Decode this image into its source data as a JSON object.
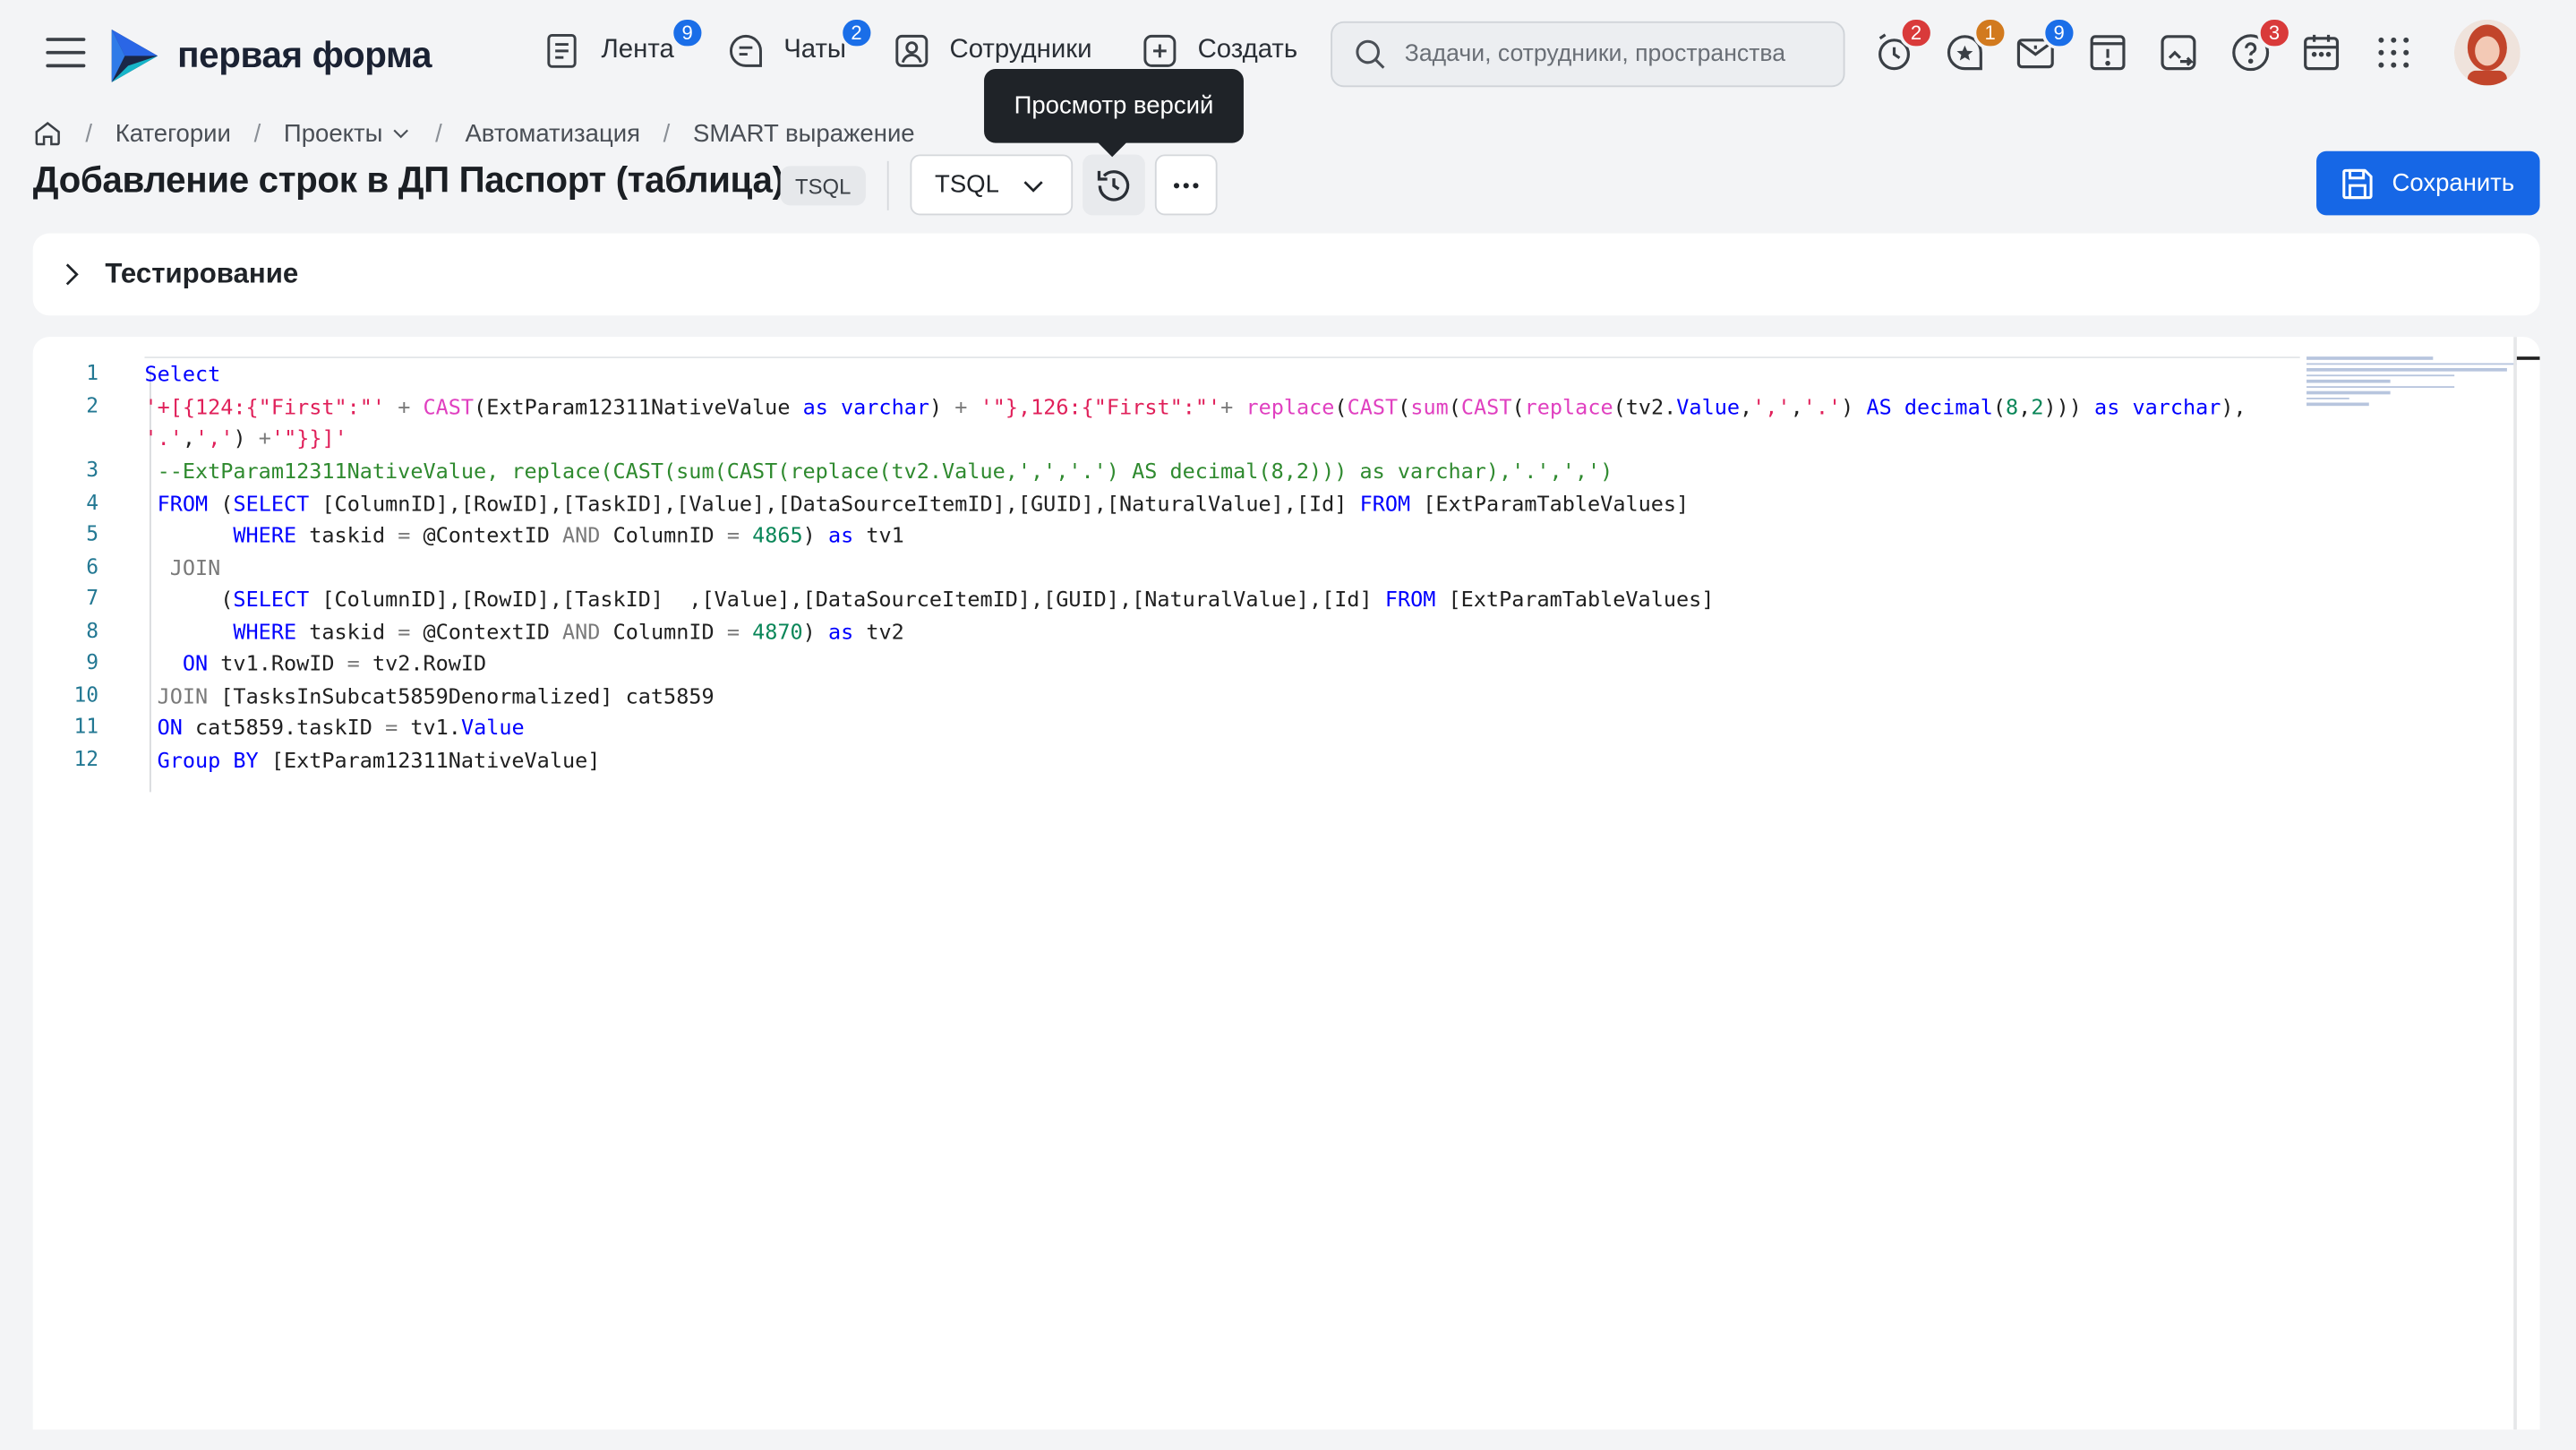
{
  "app": {
    "logo_text": "первая форма"
  },
  "nav": [
    {
      "label": "Лента",
      "badge": "9"
    },
    {
      "label": "Чаты",
      "badge": "2"
    },
    {
      "label": "Сотрудники"
    },
    {
      "label": "Создать"
    }
  ],
  "search": {
    "placeholder": "Задачи, сотрудники, пространства"
  },
  "toolbar_badges": {
    "reminders": "2",
    "favorites": "1",
    "mail": "9",
    "help": "3"
  },
  "colors": {
    "accent": "#1667e6",
    "badge_blue": "#1a6ee8",
    "badge_red": "#d93a3a",
    "badge_orange": "#d27a1e"
  },
  "breadcrumb": [
    "Категории",
    "Проекты",
    "Автоматизация",
    "SMART выражение"
  ],
  "page": {
    "title": "Добавление строк в ДП Паспорт (таблица)",
    "lang_badge": "TSQL"
  },
  "language_select": {
    "value": "TSQL"
  },
  "tooltip": "Просмотр версий",
  "save_label": "Сохранить",
  "testing_label": "Тестирование",
  "editor": {
    "line_numbers": [
      "1",
      "2",
      "3",
      "4",
      "5",
      "6",
      "7",
      "8",
      "9",
      "10",
      "11",
      "12"
    ]
  }
}
